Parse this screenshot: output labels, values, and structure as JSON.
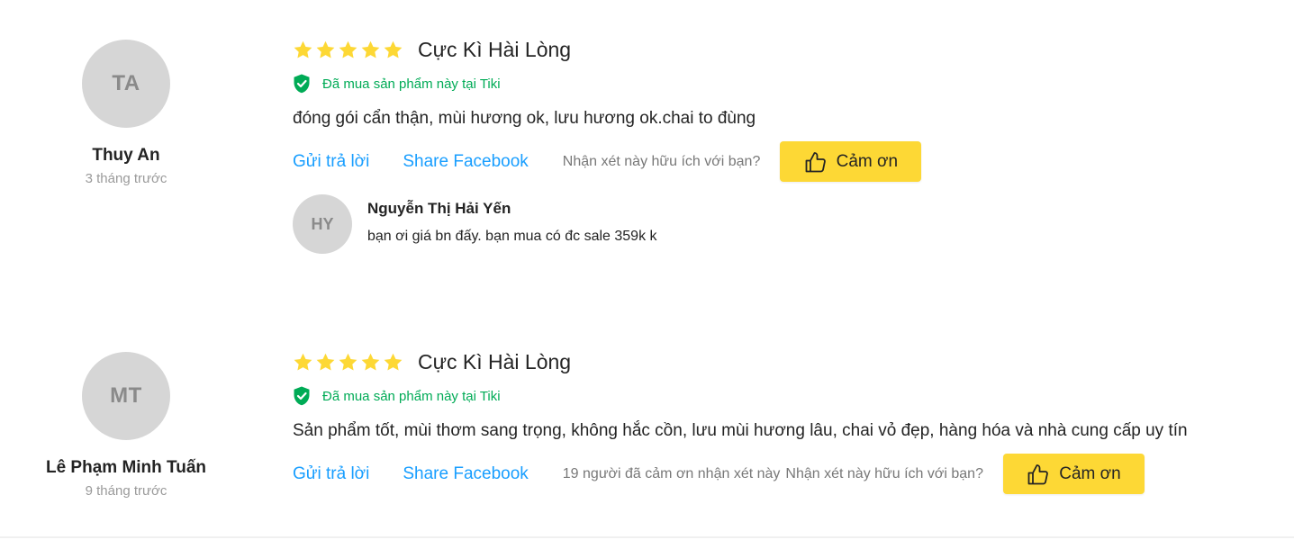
{
  "reviews": [
    {
      "avatar_initials": "TA",
      "author_name": "Thuy An",
      "time_ago": "3 tháng trước",
      "rating": 5,
      "rating_title": "Cực Kì Hài Lòng",
      "verified_text": "Đã mua sản phẩm này tại Tiki",
      "text": "đóng gói cẩn thận, mùi hương ok, lưu hương ok.chai to đùng",
      "reply_label": "Gửi trả lời",
      "share_label": "Share Facebook",
      "thanks_count_text": "",
      "helpful_question": "Nhận xét này hữu ích với bạn?",
      "thanks_button_label": "Cảm ơn",
      "replies": [
        {
          "avatar_initials": "HY",
          "author_name": "Nguyễn Thị Hải Yến",
          "text": "bạn ơi giá bn đấy. bạn mua có đc sale 359k k"
        }
      ]
    },
    {
      "avatar_initials": "MT",
      "author_name": "Lê Phạm Minh Tuấn",
      "time_ago": "9 tháng trước",
      "rating": 5,
      "rating_title": "Cực Kì Hài Lòng",
      "verified_text": "Đã mua sản phẩm này tại Tiki",
      "text": "Sản phẩm tốt, mùi thơm sang trọng, không hắc cồn, lưu mùi hương lâu, chai vỏ đẹp, hàng hóa và nhà cung cấp uy tín",
      "reply_label": "Gửi trả lời",
      "share_label": "Share Facebook",
      "thanks_count_text": "19 người đã cảm ơn nhận xét này",
      "helpful_question": "Nhận xét này hữu ích với bạn?",
      "thanks_button_label": "Cảm ơn",
      "replies": []
    }
  ],
  "colors": {
    "star": "#fdd835",
    "verified": "#00ab56",
    "link": "#189eff",
    "thanks_button": "#fdd835",
    "avatar_bg": "#d6d6d6"
  },
  "icons": {
    "star": "star-icon",
    "verified": "shield-check-icon",
    "thanks": "thumbs-up-icon"
  }
}
